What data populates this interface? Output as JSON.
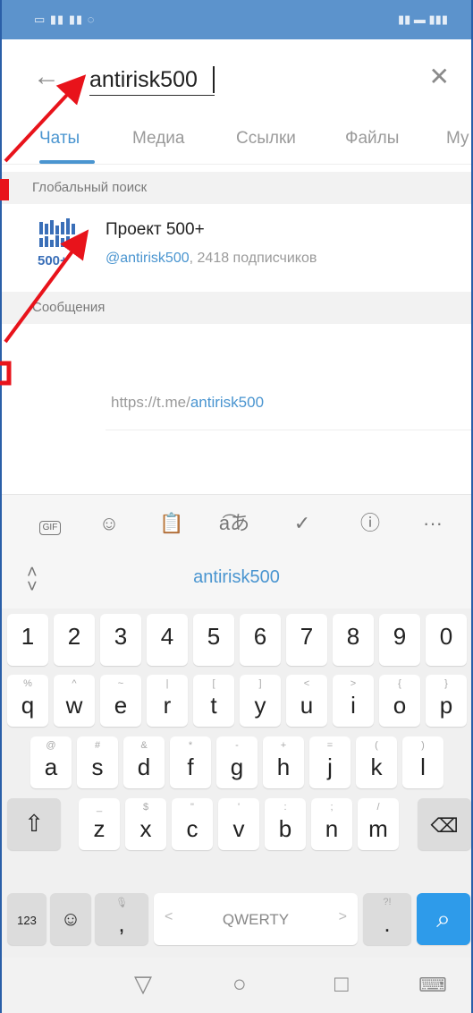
{
  "search": {
    "value": "antirisk500",
    "back_icon": "arrow-left-icon",
    "clear_icon": "close-icon"
  },
  "tabs": [
    {
      "label": "Чаты",
      "active": true
    },
    {
      "label": "Медиа",
      "active": false
    },
    {
      "label": "Ссылки",
      "active": false
    },
    {
      "label": "Файлы",
      "active": false
    },
    {
      "label": "Му",
      "active": false
    }
  ],
  "global_search": {
    "header": "Глобальный поиск",
    "result": {
      "title": "Проект 500+",
      "handle": "@antirisk500",
      "subscribers": ", 2418 подписчиков",
      "avatar_text": "500+"
    }
  },
  "messages": {
    "header": "Сообщения",
    "link_prefix": "https://t.me/",
    "link_highlight": "antirisk500"
  },
  "keyboard": {
    "suggestion": "antirisk500",
    "toolbar": {
      "gif_label": "GIF",
      "more_label": "···"
    },
    "row_numbers": [
      "1",
      "2",
      "3",
      "4",
      "5",
      "6",
      "7",
      "8",
      "9",
      "0"
    ],
    "row1": [
      {
        "main": "q",
        "hint": "%"
      },
      {
        "main": "w",
        "hint": "^"
      },
      {
        "main": "e",
        "hint": "~"
      },
      {
        "main": "r",
        "hint": "|"
      },
      {
        "main": "t",
        "hint": "["
      },
      {
        "main": "y",
        "hint": "]"
      },
      {
        "main": "u",
        "hint": "<"
      },
      {
        "main": "i",
        "hint": ">"
      },
      {
        "main": "o",
        "hint": "{"
      },
      {
        "main": "p",
        "hint": "}"
      }
    ],
    "row2": [
      {
        "main": "a",
        "hint": "@"
      },
      {
        "main": "s",
        "hint": "#"
      },
      {
        "main": "d",
        "hint": "&"
      },
      {
        "main": "f",
        "hint": "*"
      },
      {
        "main": "g",
        "hint": "-"
      },
      {
        "main": "h",
        "hint": "+"
      },
      {
        "main": "j",
        "hint": "="
      },
      {
        "main": "k",
        "hint": "("
      },
      {
        "main": "l",
        "hint": ")"
      }
    ],
    "row3": [
      {
        "main": "z",
        "hint": "_"
      },
      {
        "main": "x",
        "hint": "$"
      },
      {
        "main": "c",
        "hint": "\""
      },
      {
        "main": "v",
        "hint": "'"
      },
      {
        "main": "b",
        "hint": ":"
      },
      {
        "main": "n",
        "hint": ";"
      },
      {
        "main": "m",
        "hint": "/"
      }
    ],
    "num_key": "123",
    "emoji_key": "☺",
    "comma_key": ",",
    "space_label": "QWERTY",
    "period_key": ".",
    "period_hint": "?!",
    "mic_hint": "🎙"
  },
  "colors": {
    "accent": "#4a95d0",
    "search_key": "#2e9bea",
    "status_bar": "#5c93cc",
    "annotation": "#e8131b"
  }
}
